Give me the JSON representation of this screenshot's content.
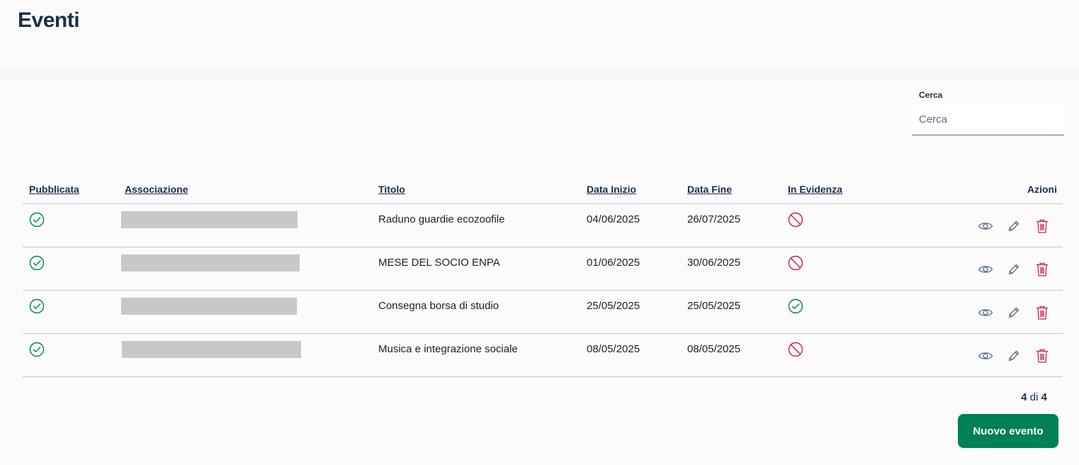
{
  "page": {
    "title": "Eventi"
  },
  "search": {
    "label": "Cerca",
    "placeholder": "Cerca",
    "value": ""
  },
  "table": {
    "columns": {
      "pubblicata": "Pubblicata",
      "associazione": "Associazione",
      "titolo": "Titolo",
      "data_inizio": "Data Inizio",
      "data_fine": "Data Fine",
      "in_evidenza": "In Evidenza",
      "azioni": "Azioni"
    },
    "rows": [
      {
        "pubblicata": "check-circle-icon",
        "titolo": "Raduno guardie ecozoofile",
        "data_inizio": "04/06/2025",
        "data_fine": "26/07/2025",
        "in_evidenza": "ban-icon"
      },
      {
        "pubblicata": "check-circle-icon",
        "titolo": "MESE DEL SOCIO ENPA",
        "data_inizio": "01/06/2025",
        "data_fine": "30/06/2025",
        "in_evidenza": "ban-icon"
      },
      {
        "pubblicata": "check-circle-icon",
        "titolo": "Consegna borsa di studio",
        "data_inizio": "25/05/2025",
        "data_fine": "25/05/2025",
        "in_evidenza": "check-circle-icon"
      },
      {
        "pubblicata": "check-circle-icon",
        "titolo": "Musica e integrazione sociale",
        "data_inizio": "08/05/2025",
        "data_fine": "08/05/2025",
        "in_evidenza": "ban-icon"
      }
    ]
  },
  "pagination": {
    "shown": "4",
    "separator": "di",
    "total": "4"
  },
  "actions": {
    "new_event_label": "Nuovo evento"
  },
  "colors": {
    "title": "#1b2f4a",
    "success": "#008055",
    "danger": "#cc1f4e",
    "action_icon": "#5c6f82",
    "primary_button": "#008055"
  }
}
